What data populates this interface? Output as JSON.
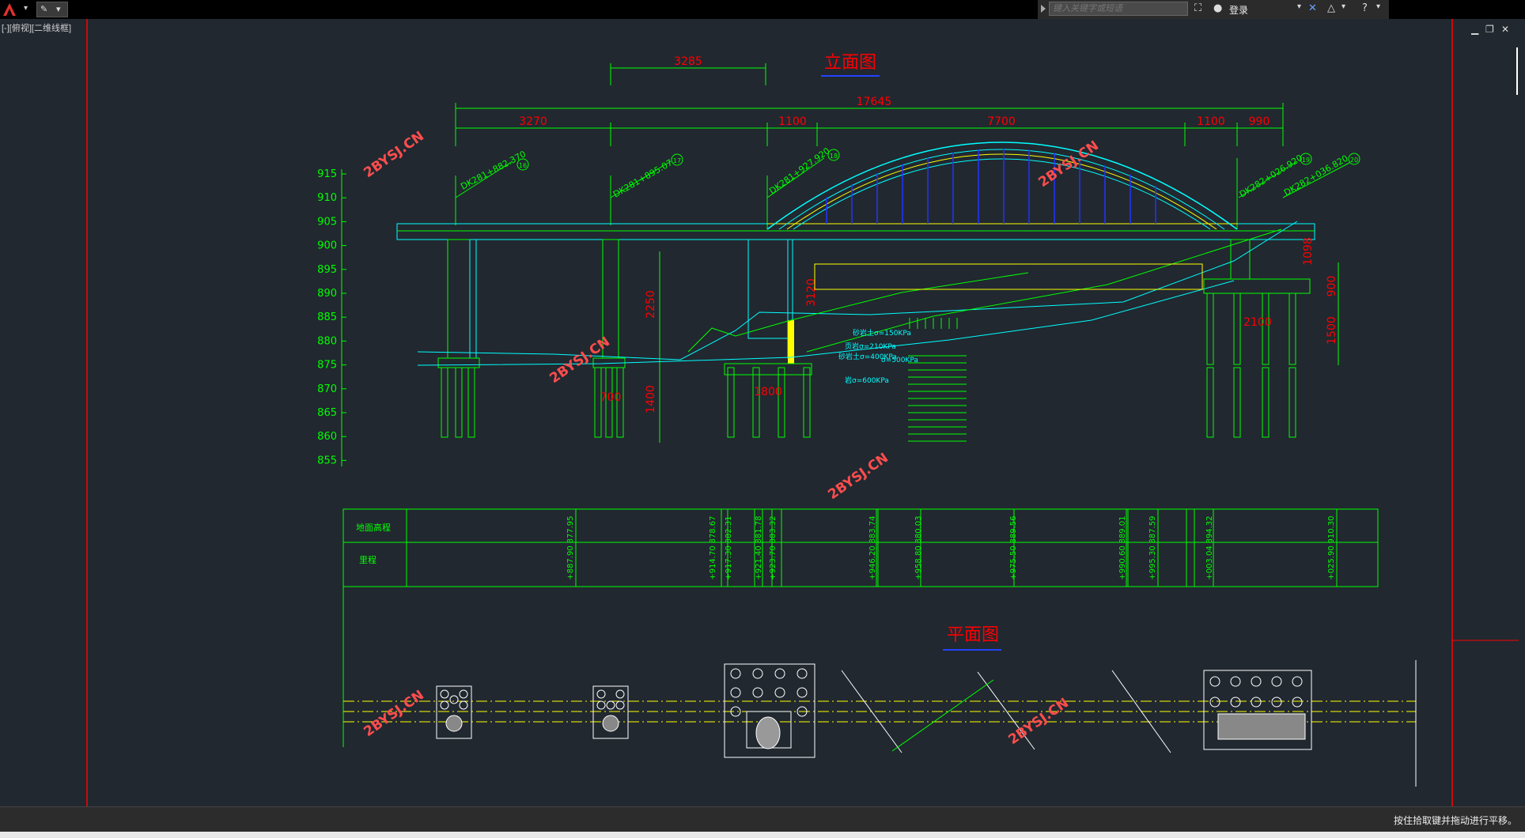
{
  "toolbar": {
    "search_placeholder": "键入关键字或短语",
    "login_label": "登录"
  },
  "viewport": {
    "label": "[-][俯视][二维线框]"
  },
  "status": {
    "message": "按住拾取键并拖动进行平移。"
  },
  "drawing": {
    "elevation_title": "立面图",
    "plan_title": "平面图",
    "dims_top": [
      "3285",
      "17645",
      "3270",
      "1100",
      "7700",
      "1100",
      "990"
    ],
    "elev_scale": [
      "915",
      "910",
      "905",
      "900",
      "895",
      "890",
      "885",
      "880",
      "875",
      "870",
      "865",
      "860",
      "855"
    ],
    "stations": [
      "DK281+882.370",
      "DK281+895.07",
      "DK281+927.920",
      "DK282+026.920",
      "DK282+036.820"
    ],
    "station_nums": [
      "16",
      "17",
      "18",
      "19",
      "20"
    ],
    "pier_dims": [
      "2250",
      "1400",
      "3120",
      "1800",
      "2100",
      "1098",
      "900",
      "1500",
      "700"
    ],
    "soil_labels": [
      "砂岩土σ=150KPa",
      "页岩σ=210KPa",
      "砂岩土σ=400KPa",
      "σ=500KPa",
      "岩σ=600KPa"
    ],
    "watermark": "2BYSJ.CN",
    "table": {
      "row1_label": "地面高程",
      "row2_label": "里程",
      "row1_values": [
        "877.95",
        "878.67",
        "882.31",
        "881.78",
        "883.32",
        "883.74",
        "880.03",
        "889.56",
        "889.01",
        "887.59",
        "894.32",
        "910.30"
      ],
      "row2_values": [
        "+887.90",
        "+914.70",
        "+917.30",
        "+921.40",
        "+923.70",
        "+946.20",
        "+958.80",
        "+975.50",
        "+990.60",
        "+995.30",
        "+003.04",
        "+025.90"
      ]
    }
  },
  "colors": {
    "line": "#00ff00",
    "dim": "#ff0000",
    "arch": "#00ffff",
    "deck": "#ffff00",
    "hanger": "#0000ff"
  }
}
